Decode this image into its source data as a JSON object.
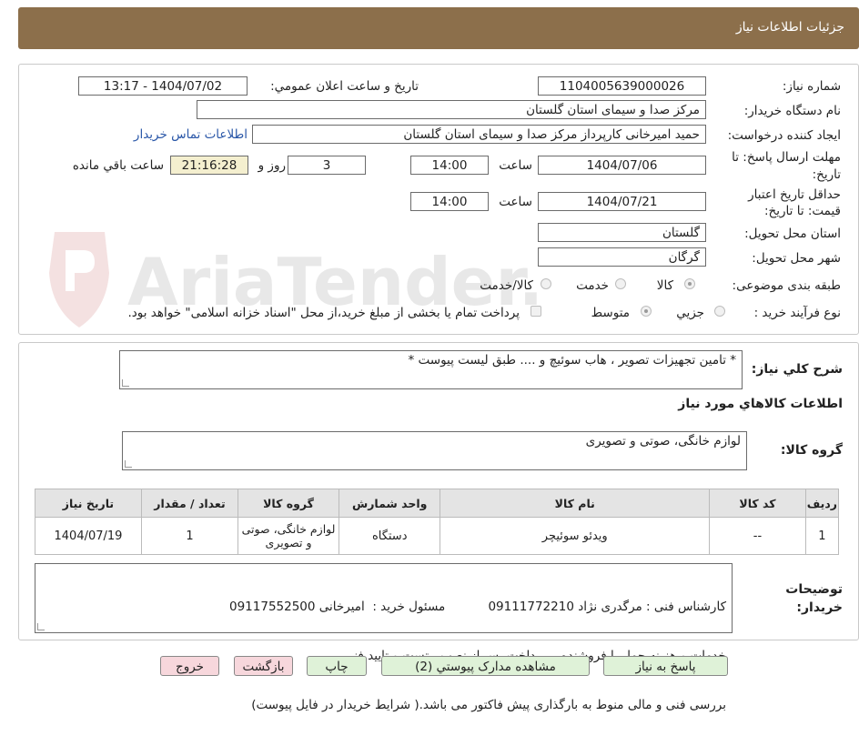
{
  "header": {
    "title": "جزئیات اطلاعات نیاز"
  },
  "watermark": {
    "text": "AriaTender.neT"
  },
  "form": {
    "need_number_label": "شماره نیاز:",
    "need_number": "1104005639000026",
    "announce_label": "تاریخ و ساعت اعلان عمومي:",
    "announce_value": "1404/07/02 - 13:17",
    "buyer_org_label": "نام دستگاه خريدار:",
    "buyer_org": "مرکز صدا و سیمای استان گلستان",
    "requester_label": "ایجاد کننده درخواست:",
    "requester": "حمید امیرخانی کارپرداز مرکز صدا و سیمای استان گلستان",
    "contact_link": "اطلاعات تماس خريدار",
    "deadline_label_1": "مهلت ارسال پاسخ: تا",
    "deadline_label_2": "تاریخ:",
    "deadline_date": "1404/07/06",
    "time_label": "ساعت",
    "deadline_time": "14:00",
    "days_value": "3",
    "days_label": "روز و",
    "remaining_time": "21:16:28",
    "remaining_label": "ساعت باقي مانده",
    "validity_label_1": "حداقل تاريخ اعتبار",
    "validity_label_2": "قيمت: تا تاريخ:",
    "validity_date": "1404/07/21",
    "validity_time_label": "ساعت",
    "validity_time": "14:00",
    "province_label": "استان محل تحویل:",
    "province": "گلستان",
    "city_label": "شهر محل تحویل:",
    "city": "گرگان",
    "category_label": "طبقه بندی موضوعی:",
    "category_options": [
      "کالا",
      "خدمت",
      "کالا/خدمت"
    ],
    "process_label": "نوع فرآیند خرید :",
    "process_options": [
      "جزيي",
      "متوسط"
    ],
    "payment_note": "پرداخت تمام یا بخشی از مبلغ خرید،از محل \"اسناد خزانه اسلامی\" خواهد بود."
  },
  "description": {
    "label": "شرح کلي نياز:",
    "value": "* تامین تجهیزات تصویر ، هاب سوئیچ و .... طبق لیست پیوست *"
  },
  "goods": {
    "section_title": "اطلاعات کالاهاي مورد نياز",
    "group_label": "گروه کالا:",
    "group_value": "لوازم خانگی، صوتی و تصویری",
    "columns": [
      "رديف",
      "کد کالا",
      "نام کالا",
      "واحد شمارش",
      "گروه کالا",
      "تعداد / مقدار",
      "تاريخ نياز"
    ],
    "rows": [
      [
        "1",
        "--",
        "ویدئو سوئیچر",
        "دستگاه",
        "لوازم خانگی، صوتی و تصویری",
        "1",
        "1404/07/19"
      ]
    ]
  },
  "buyer_notes": {
    "label_1": "توضيحات",
    "label_2": "خريدار:",
    "line1": "کارشناس فنی : مرگدری نژاد 09111772210           مسئول خرید :  امیرخانی 09117552500",
    "line2": "خدمات و هزینه حمل با فروشنده ،  پرداخت پس از نصب ، تست و تایید فنی",
    "line3": "بررسی فنی و مالی منوط به بارگذاری پیش فاکتور می باشد.( شرایط خریدار در فایل پیوست)"
  },
  "buttons": {
    "reply": "پاسخ به نياز",
    "attachments": "مشاهده مدارک پيوستي (2)",
    "print": "چاپ",
    "back": "بازگشت",
    "exit": "خروج"
  }
}
